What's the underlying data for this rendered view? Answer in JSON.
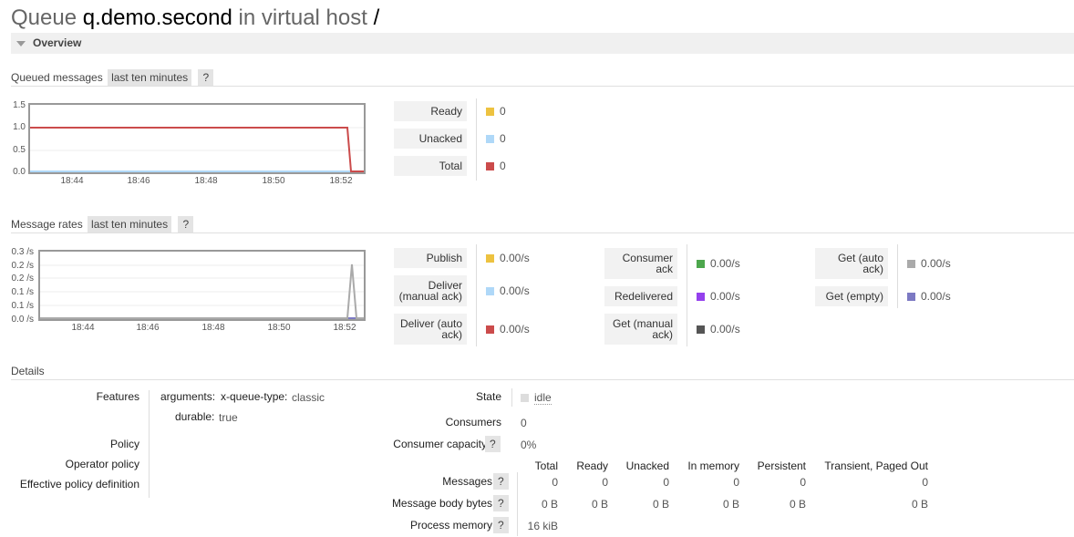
{
  "header": {
    "prefix": "Queue",
    "queue_name": "q.demo.second",
    "middle": "in virtual host",
    "vhost": "/"
  },
  "overview": {
    "label": "Overview"
  },
  "queued_messages": {
    "heading": "Queued messages",
    "range": "last ten minutes",
    "help": "?",
    "yticks": [
      "1.5",
      "1.0",
      "0.5",
      "0.0"
    ],
    "xticks": [
      "18:44",
      "18:46",
      "18:48",
      "18:50",
      "18:52"
    ],
    "legend": [
      {
        "label": "Ready",
        "value": "0",
        "color": "#edc240"
      },
      {
        "label": "Unacked",
        "value": "0",
        "color": "#afd8f8"
      },
      {
        "label": "Total",
        "value": "0",
        "color": "#cb4b4b"
      }
    ]
  },
  "message_rates": {
    "heading": "Message rates",
    "range": "last ten minutes",
    "help": "?",
    "yticks": [
      "0.3 /s",
      "0.2 /s",
      "0.2 /s",
      "0.1 /s",
      "0.1 /s",
      "0.0 /s"
    ],
    "xticks": [
      "18:44",
      "18:46",
      "18:48",
      "18:50",
      "18:52"
    ],
    "col1": [
      {
        "label": "Publish",
        "value": "0.00/s",
        "color": "#edc240"
      },
      {
        "label": "Deliver\n(manual ack)",
        "value": "0.00/s",
        "color": "#afd8f8"
      },
      {
        "label": "Deliver (auto\nack)",
        "value": "0.00/s",
        "color": "#cb4b4b"
      }
    ],
    "col2": [
      {
        "label": "Consumer\nack",
        "value": "0.00/s",
        "color": "#4da74d"
      },
      {
        "label": "Redelivered",
        "value": "0.00/s",
        "color": "#9440ed"
      },
      {
        "label": "Get (manual\nack)",
        "value": "0.00/s",
        "color": "#555555"
      }
    ],
    "col3": [
      {
        "label": "Get (auto\nack)",
        "value": "0.00/s",
        "color": "#aaaaaa"
      },
      {
        "label": "Get (empty)",
        "value": "0.00/s",
        "color": "#7c79c3"
      }
    ]
  },
  "details": {
    "heading": "Details",
    "features_label": "Features",
    "arguments_label": "arguments:",
    "arg_key": "x-queue-type:",
    "arg_value": "classic",
    "durable_label": "durable:",
    "durable_value": "true",
    "policy_label": "Policy",
    "operator_policy_label": "Operator policy",
    "effective_policy_label": "Effective policy definition",
    "state_label": "State",
    "state_value": "idle",
    "consumers_label": "Consumers",
    "consumers_value": "0",
    "capacity_label": "Consumer capacity",
    "capacity_help": "?",
    "capacity_value": "0%",
    "table": {
      "headers": [
        "Total",
        "Ready",
        "Unacked",
        "In memory",
        "Persistent",
        "Transient, Paged Out"
      ],
      "rows": [
        {
          "label": "Messages",
          "help": "?",
          "values": [
            "0",
            "0",
            "0",
            "0",
            "0",
            "0"
          ]
        },
        {
          "label": "Message body bytes",
          "help": "?",
          "values": [
            "0 B",
            "0 B",
            "0 B",
            "0 B",
            "0 B",
            "0 B"
          ]
        },
        {
          "label": "Process memory",
          "help": "?",
          "values": [
            "16 kiB"
          ]
        }
      ]
    }
  }
}
